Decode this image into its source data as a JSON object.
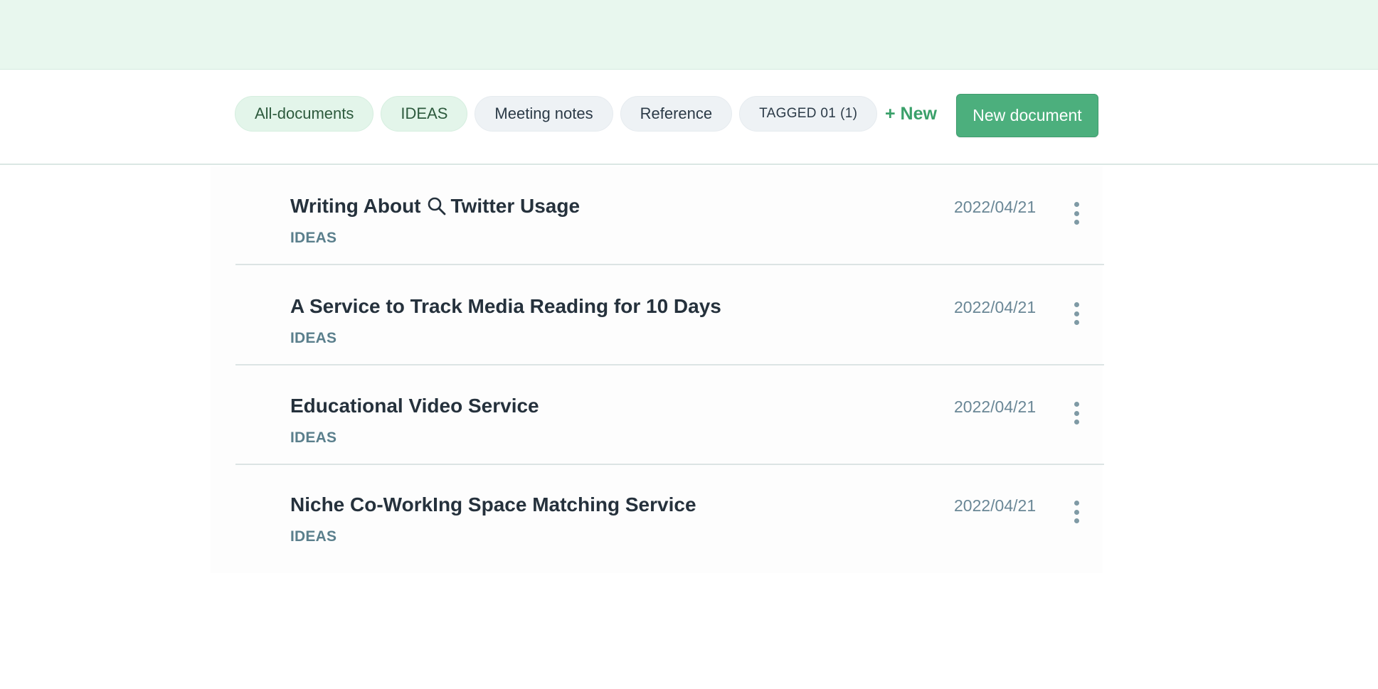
{
  "tabs": [
    {
      "label": "All-documents",
      "style": "green"
    },
    {
      "label": "IDEAS",
      "style": "green"
    },
    {
      "label": "Meeting notes",
      "style": "gray"
    },
    {
      "label": "Reference",
      "style": "gray"
    },
    {
      "label": "TAGGED 01",
      "count": "(1)",
      "style": "gray"
    }
  ],
  "toolbar": {
    "new_link_label": "+ New",
    "new_document_label": "New document"
  },
  "documents": [
    {
      "title_before": "Writing About",
      "title_icon": "search-icon",
      "title_after": "Twitter Usage",
      "tag": "IDEAS",
      "date": "2022/04/21"
    },
    {
      "title": "A Service to Track Media Reading for 10 Days",
      "tag": "IDEAS",
      "date": "2022/04/21"
    },
    {
      "title": "Educational Video Service",
      "tag": "IDEAS",
      "date": "2022/04/21"
    },
    {
      "title": "Niche Co-WorkIng Space Matching Service",
      "tag": "IDEAS",
      "date": "2022/04/21"
    }
  ],
  "colors": {
    "top_band": "#e8f7ee",
    "accent": "#4caf7d",
    "accent_text": "#3aa06a",
    "title_text": "#25313c",
    "tag_text": "#5a7f8c",
    "date_text": "#6a8796"
  }
}
